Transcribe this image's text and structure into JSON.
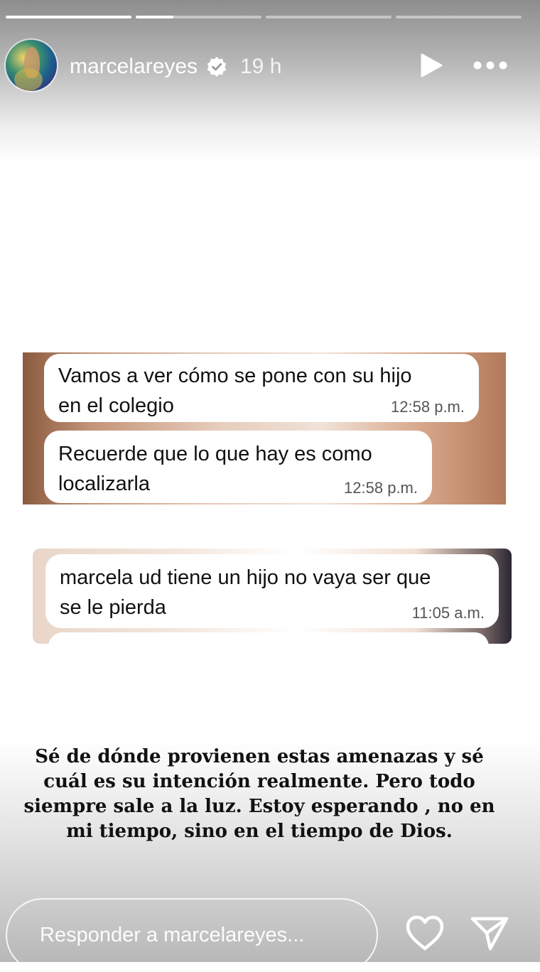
{
  "story": {
    "progress": [
      1.0,
      0.3,
      0.0,
      0.0
    ],
    "username": "marcelareyes",
    "time": "19 h",
    "icons": {
      "verified": "verified-badge-icon",
      "play": "play-icon",
      "more": "more-icon",
      "heart": "heart-icon",
      "send": "send-icon"
    }
  },
  "screenshots": {
    "first": {
      "messages": [
        {
          "lines": [
            "Vamos a ver cómo se pone con su hijo",
            "en el colegio"
          ],
          "time": "12:58 p.m."
        },
        {
          "lines": [
            "Recuerde que lo que hay es como",
            "localizarla"
          ],
          "time": "12:58 p.m."
        }
      ]
    },
    "second": {
      "messages": [
        {
          "lines": [
            "marcela ud tiene un hijo no vaya ser que",
            "se le pierda"
          ],
          "time": "11:05 a.m."
        }
      ]
    }
  },
  "caption": {
    "lines": [
      "Sé de dónde provienen estas amenazas y sé",
      "cuál es su intención realmente. Pero todo",
      "siempre sale a la luz. Estoy esperando , no en",
      "mi tiempo, sino en el tiempo de Dios."
    ]
  },
  "reply": {
    "placeholder": "Responder a marcelareyes..."
  }
}
